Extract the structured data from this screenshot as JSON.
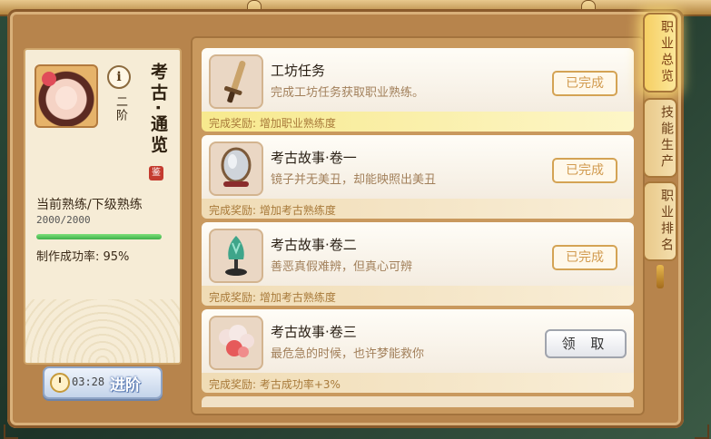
{
  "profile": {
    "info_icon": "i",
    "rank": "二阶",
    "career_name": "考古·通览",
    "seal_char": "鉴",
    "proficiency_label": "当前熟练/下级熟练",
    "proficiency_value": "2000/2000",
    "proficiency_progress": 1.0,
    "success_rate": "制作成功率: 95%"
  },
  "advance_button": {
    "timer": "03:28",
    "label": "进阶"
  },
  "tasks": [
    {
      "title": "工坊任务",
      "desc": "完成工坊任务获取职业熟练。",
      "status": "已完成",
      "reward": "完成奖励: 增加职业熟练度",
      "icon": "dagger-icon"
    },
    {
      "title": "考古故事·卷一",
      "desc": "镜子并无美丑，却能映照出美丑",
      "status": "已完成",
      "reward": "完成奖励: 增加考古熟练度",
      "icon": "mirror-icon"
    },
    {
      "title": "考古故事·卷二",
      "desc": "善恶真假难辨，但真心可辨",
      "status": "已完成",
      "reward": "完成奖励: 增加考古熟练度",
      "icon": "jade-bowl-icon"
    },
    {
      "title": "考古故事·卷三",
      "desc": "最危急的时候，也许梦能救你",
      "status": "领 取",
      "reward": "完成奖励: 考古成功率+3%",
      "icon": "dream-cloud-icon"
    }
  ],
  "side_tabs": [
    "职业总览",
    "技能生产",
    "职业排名"
  ],
  "colors": {
    "done_border": "#d4a354",
    "progress_fill": "#3cb14a",
    "active_tab": "#f6cf63"
  }
}
